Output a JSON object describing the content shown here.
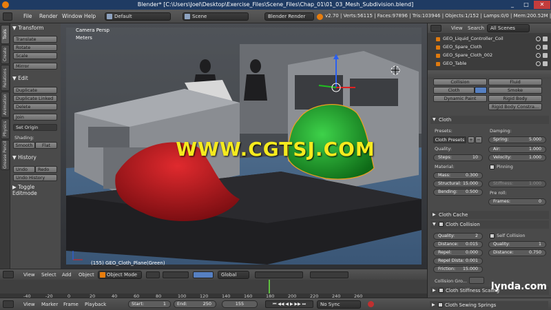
{
  "window": {
    "title": "Blender* [C:\\Users\\Joel\\Desktop\\Exercise_Files\\Scene_Files\\Chap_01\\01_03_Mesh_Subdivision.blend]",
    "min": "_",
    "max": "□",
    "close": "✕"
  },
  "info": {
    "menus": [
      "File",
      "Render",
      "Window",
      "Help"
    ],
    "layout": "Default",
    "scene": "Scene",
    "engine": "Blender Render",
    "stats": "v2.70 | Verts:56115 | Faces:97896 | Tris:103946 | Objects:1/152 | Lamps:0/0 | Mem:200.52M | GEO_Cloth"
  },
  "toolshelf": {
    "tabs": [
      "Tools",
      "Create",
      "Relations",
      "Animation",
      "Physics",
      "Grease Pencil"
    ],
    "transform_header": "Transform",
    "transform": [
      "Translate",
      "Rotate",
      "Scale",
      "Mirror"
    ],
    "edit_header": "Edit",
    "edit": [
      "Duplicate",
      "Duplicate Linked",
      "Delete",
      "Join"
    ],
    "set_origin": "Set Origin",
    "shading_label": "Shading:",
    "smooth": "Smooth",
    "flat": "Flat",
    "history_header": "History",
    "undo": "Undo",
    "redo": "Redo",
    "undo_history": "Undo History",
    "toggle": "Toggle Editmode"
  },
  "viewport": {
    "view_name": "Camera Persp",
    "units": "Meters",
    "object_label": "(155) GEO_Cloth_Plane(Green)",
    "watermark": "WWW.CGTSJ.COM"
  },
  "viewheader": {
    "menus": [
      "View",
      "Select",
      "Add",
      "Object"
    ],
    "mode": "Object Mode",
    "orientation": "Global"
  },
  "timeline": {
    "ticks": [
      "-40",
      "-20",
      "0",
      "20",
      "40",
      "60",
      "80",
      "100",
      "120",
      "140",
      "160",
      "180",
      "200",
      "220",
      "240",
      "260"
    ],
    "menus": [
      "View",
      "Marker",
      "Frame",
      "Playback"
    ],
    "start_label": "Start:",
    "start": "1",
    "end_label": "End:",
    "end": "250",
    "current": "155",
    "sync": "No Sync"
  },
  "outliner": {
    "view": "View",
    "search": "Search",
    "scenes": "All Scenes",
    "rows": [
      "GEO_Liquid_Controller_Coil",
      "GEO_Spare_Cloth",
      "GEO_Spare_Cloth_002",
      "GEO_Table"
    ]
  },
  "properties": {
    "phys_buttons": [
      "Collision",
      "Fluid",
      "Cloth",
      "Smoke",
      "Dynamic Paint",
      "Rigid Body",
      "Rigid Body Constra..."
    ],
    "cloth_header": "Cloth",
    "presets_label": "Presets:",
    "presets_value": "Cloth Presets",
    "quality_label": "Quality:",
    "steps_label": "Steps:",
    "steps": "10",
    "material_label": "Material:",
    "mass_label": "Mass:",
    "mass": "0.300",
    "structural_label": "Structural:",
    "structural": "15.000",
    "bending_label": "Bending:",
    "bending": "0.500",
    "damping_label": "Damping:",
    "spring_label": "Spring:",
    "spring": "5.000",
    "air_label": "Air:",
    "air": "1.000",
    "velocity_label": "Velocity:",
    "velocity": "1.000",
    "pinning": "Pinning",
    "stiffness_label": "Stiffness:",
    "stiffness": "1.000",
    "preroll_label": "Pre roll:",
    "frames_label": "Frames:",
    "frames": "0",
    "cache_header": "Cloth Cache",
    "collision_header": "Cloth Collision",
    "c_quality_label": "Quality:",
    "c_quality": "2",
    "c_distance_label": "Distance:",
    "c_distance": "0.015",
    "repel_label": "Repel:",
    "repel": "0.000",
    "repel_dist_label": "Repel Dista:",
    "repel_dist": "0.001",
    "friction_label": "Friction:",
    "friction": "15.000",
    "self_collision": "Self Collision",
    "s_quality_label": "Quality:",
    "s_quality": "1",
    "s_distance_label": "Distance:",
    "s_distance": "0.750",
    "collision_group": "Collision Gro...",
    "stiffness_header": "Cloth Stiffness Scaling",
    "sewing_header": "Cloth Sewing Springs"
  },
  "branding": {
    "lynda": "lynda.com"
  },
  "colors": {
    "accent": "#e87d0d",
    "selected_blue": "#5680c2",
    "cloth_green": "#1fa82a",
    "cloth_red": "#b8141a"
  }
}
